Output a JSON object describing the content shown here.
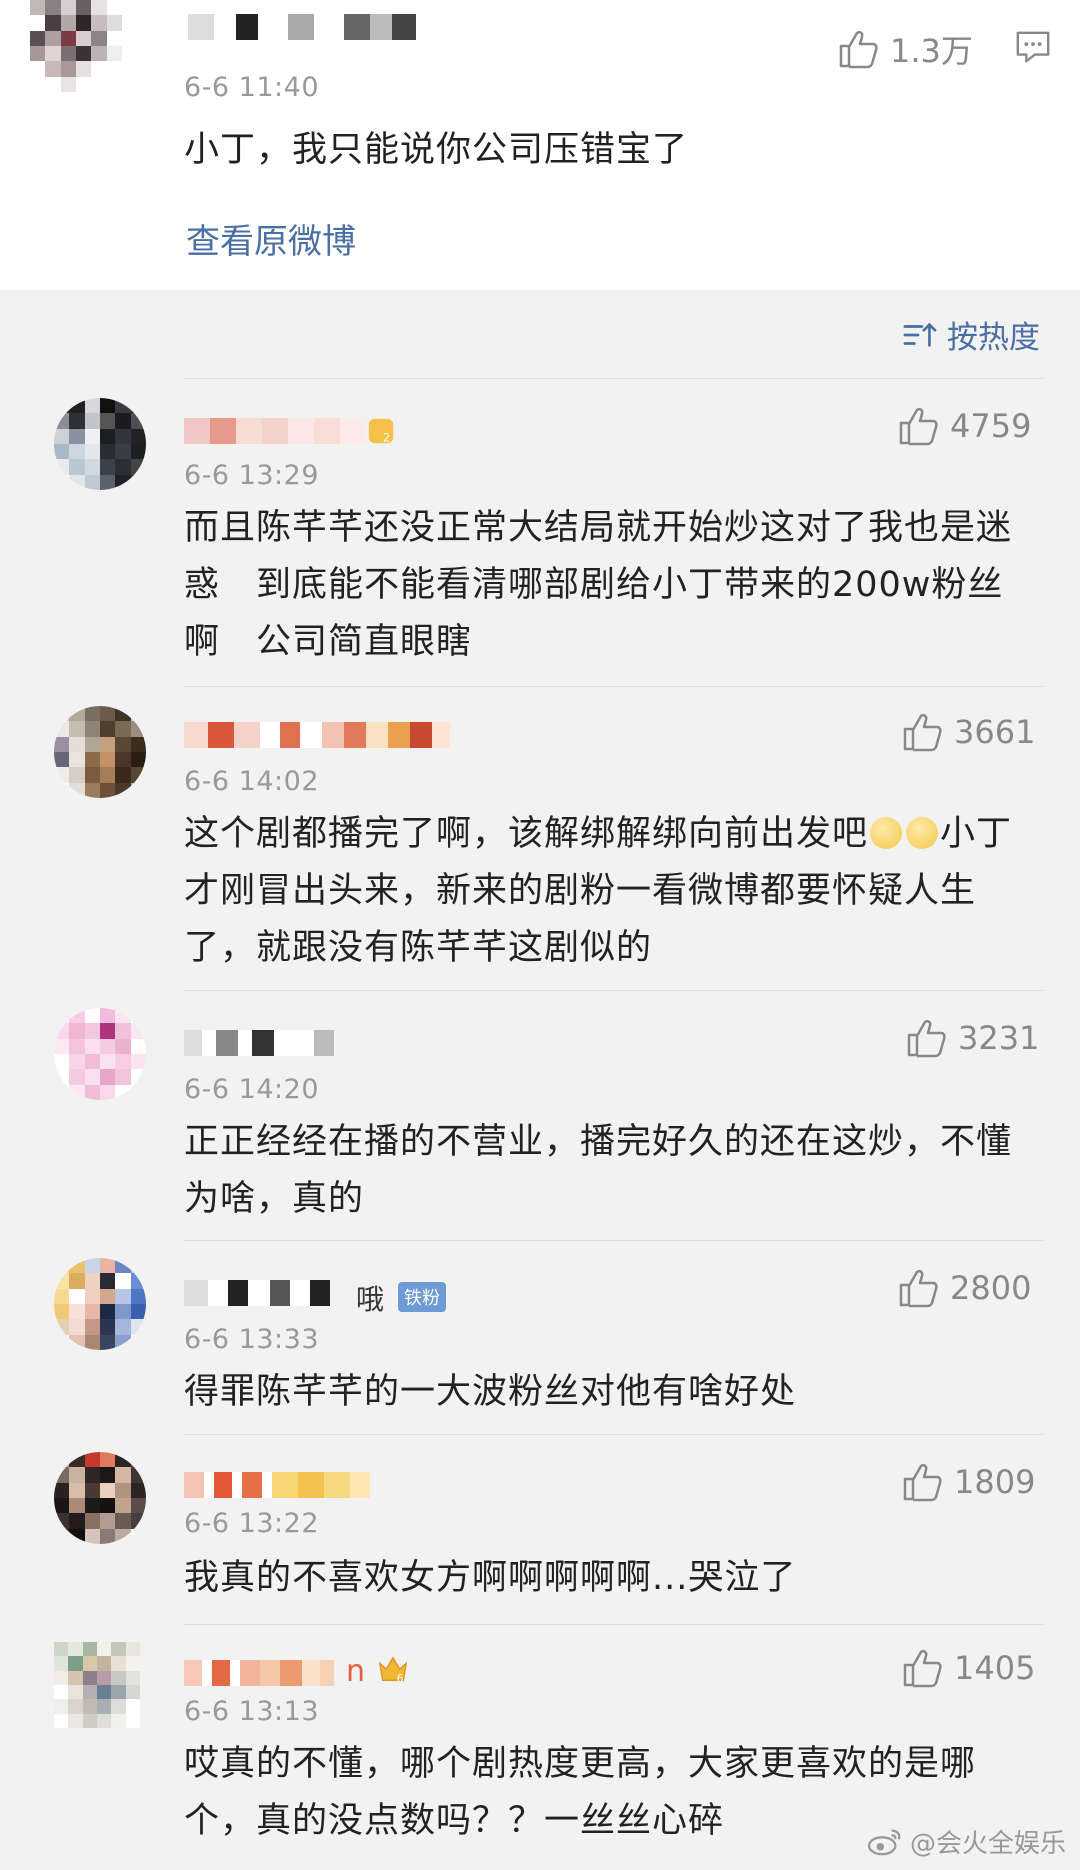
{
  "top_comment": {
    "time": "6-6 11:40",
    "text": "小丁，我只能说你公司压错宝了",
    "likes": "1.3万",
    "view_original": "查看原微博"
  },
  "sort_label": "按热度",
  "replies": [
    {
      "time": "6-6 13:29",
      "likes": "4759",
      "text": "而且陈芊芊还没正常大结局就开始炒这对了我也是迷惑　到底能不能看清哪部剧给小丁带来的200w粉丝啊　公司简直眼瞎"
    },
    {
      "time": "6-6 14:02",
      "likes": "3661",
      "text_a": "这个剧都播完了啊，该解绑解绑向前出发吧",
      "text_b": "小丁才刚冒出头来，新来的剧粉一看微博都要怀疑人生了，就跟没有陈芊芊这剧似的"
    },
    {
      "time": "6-6 14:20",
      "likes": "3231",
      "text": "正正经经在播的不营业，播完好久的还在这炒，不懂为啥，真的"
    },
    {
      "time": "6-6 13:33",
      "likes": "2800",
      "name_tail": "哦",
      "badge": "铁粉",
      "text": "得罪陈芊芊的一大波粉丝对他有啥好处"
    },
    {
      "time": "6-6 13:22",
      "likes": "1809",
      "text": "我真的不喜欢女方啊啊啊啊啊...哭泣了"
    },
    {
      "time": "6-6 13:13",
      "likes": "1405",
      "name_tail": "n",
      "text": "哎真的不懂，哪个剧热度更高，大家更喜欢的是哪个，真的没点数吗？？一丝丝心碎"
    }
  ],
  "watermark": "@会火全娱乐",
  "icons": {
    "like": "thumbs-up-icon",
    "comment": "comment-icon",
    "sort": "sort-icon",
    "weibo": "weibo-logo-icon"
  }
}
